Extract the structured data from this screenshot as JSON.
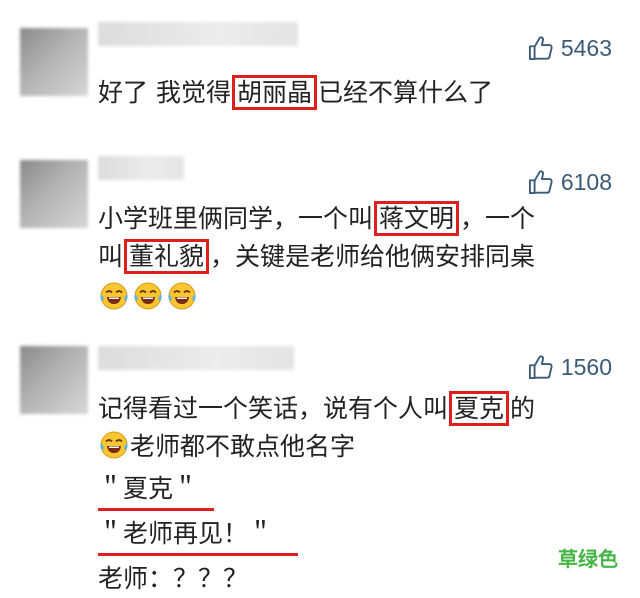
{
  "comments": [
    {
      "likes": "5463",
      "line1": {
        "pre": "好了 我觉得",
        "boxed": "胡丽晶",
        "post": "已经不算什么了"
      }
    },
    {
      "likes": "6108",
      "line1": {
        "pre": "小学班里俩同学，一个叫",
        "boxed": "蒋文明",
        "post": "，一个"
      },
      "line2": {
        "pre": "叫",
        "boxed": "董礼貌",
        "post": "，关键是老师给他俩安排同桌"
      },
      "emojis": [
        "tears-of-joy",
        "tears-of-joy",
        "tears-of-joy"
      ]
    },
    {
      "likes": "1560",
      "line1": {
        "pre": "记得看过一个笑话，说有个人叫",
        "boxed": "夏克",
        "post": "的"
      },
      "line2": "老师都不敢点他名字",
      "line3": "＂夏克＂",
      "line4": "＂老师再见！＂",
      "line5": "老师：？？？"
    }
  ],
  "watermark": "草绿色",
  "colors": {
    "highlight": "#e01e1e",
    "like": "#3c5a78",
    "watermark": "#45b545"
  },
  "icons": [
    "thumbs-up-icon",
    "tears-of-joy-emoji"
  ]
}
